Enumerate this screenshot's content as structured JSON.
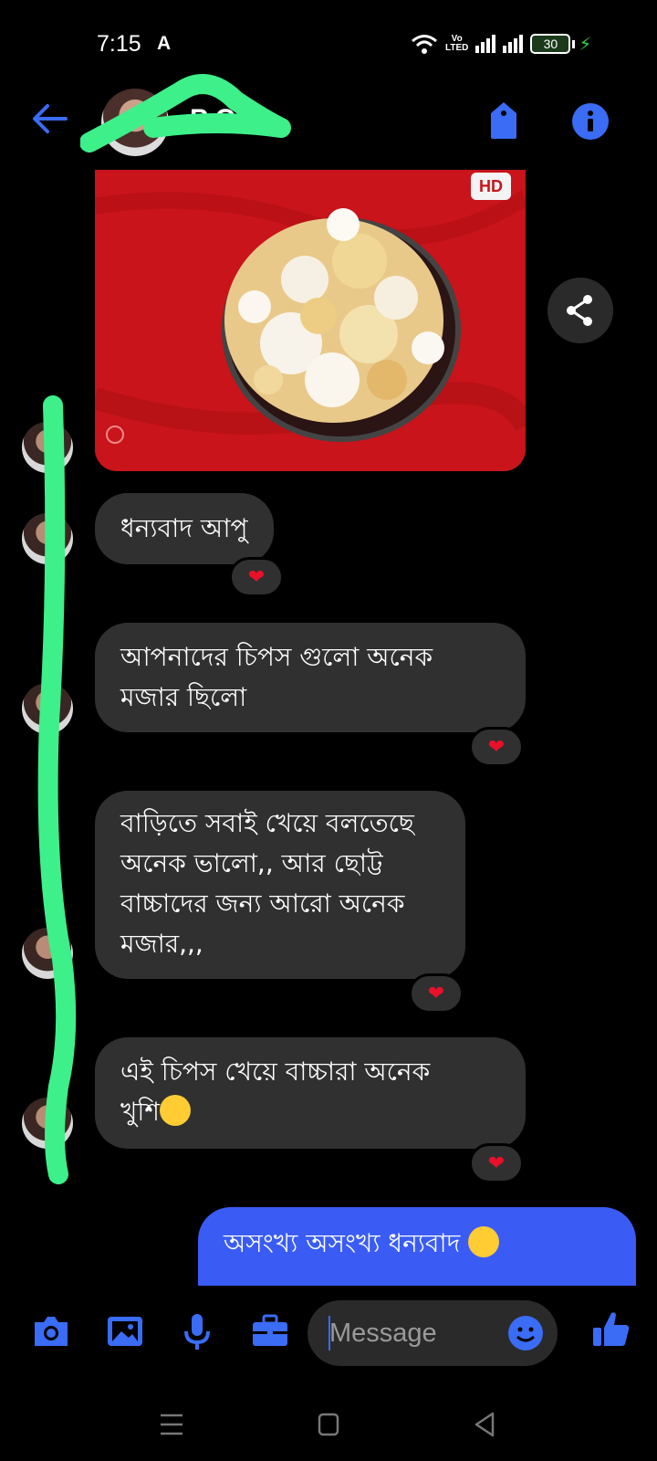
{
  "status_bar": {
    "time": "7:15",
    "indicator": "A",
    "volte_top": "Vo",
    "volte_bottom": "LTED",
    "battery": "30"
  },
  "header": {
    "contact_name": "P C",
    "back_icon": "arrow-back-icon",
    "tag_icon": "tag-icon",
    "info_icon": "info-icon"
  },
  "media": {
    "badge": "HD",
    "share_icon": "share-icon"
  },
  "messages": [
    {
      "text": "ধন্যবাদ আপু",
      "reaction": "❤"
    },
    {
      "line1": "আপনাদের চিপস গুলো অনেক",
      "line2": "মজার ছিলো",
      "reaction": "❤"
    },
    {
      "line1": "বাড়িতে সবাই খেয়ে বলতেছে",
      "line2": "অনেক ভালো,, আর ছোট্ট",
      "line3": "বাচ্চাদের জন্য আরো অনেক",
      "line4": "মজার,,,",
      "reaction": "❤"
    },
    {
      "line1": "এই চিপস খেয়ে বাচ্চারা অনেক",
      "line2": "খুশি",
      "reaction": "❤"
    }
  ],
  "sent_message": {
    "text": "অসংখ্য অসংখ্য ধন্যবাদ"
  },
  "composer": {
    "placeholder": "Message"
  },
  "colors": {
    "accent": "#3a5cf5",
    "bubble": "#303030",
    "highlight_scribble": "#3df08a",
    "photo_bg": "#c8141a"
  }
}
